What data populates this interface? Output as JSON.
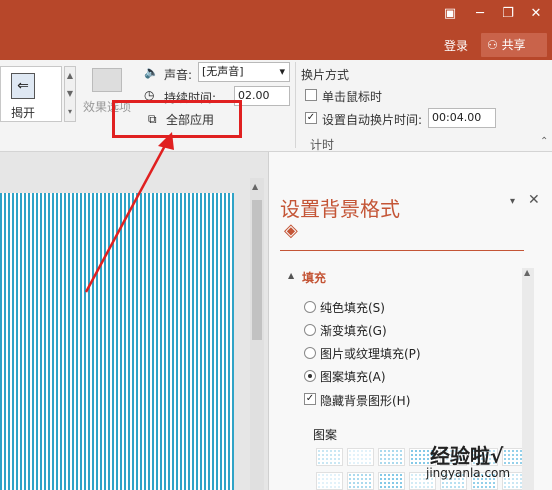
{
  "titlebar": {
    "login": "登录",
    "share": "共享"
  },
  "ribbon": {
    "reveal_label": "揭开",
    "effect_options": "效果选项",
    "sound_label": "声音:",
    "sound_value": "[无声音]",
    "duration_label": "持续时间:",
    "duration_value": "02.00",
    "apply_all": "全部应用",
    "advance_title": "换片方式",
    "on_click": "单击鼠标时",
    "after_time": "设置自动换片时间:",
    "after_time_value": "00:04.00",
    "timing_group": "计时"
  },
  "pane": {
    "title": "设置背景格式",
    "fill_section": "填充",
    "options": [
      {
        "label": "纯色填充(S)"
      },
      {
        "label": "渐变填充(G)"
      },
      {
        "label": "图片或纹理填充(P)"
      },
      {
        "label": "图案填充(A)"
      }
    ],
    "hide_bg": "隐藏背景图形(H)",
    "pattern_label": "图案",
    "selected_option_index": 3
  },
  "watermark": {
    "line1": "经验啦√",
    "line2": "jingyanla.com"
  },
  "colors": {
    "titlebar": "#b7472a",
    "accent": "#c45536",
    "stripe": "#2fa3c7",
    "highlight": "#e02020"
  }
}
